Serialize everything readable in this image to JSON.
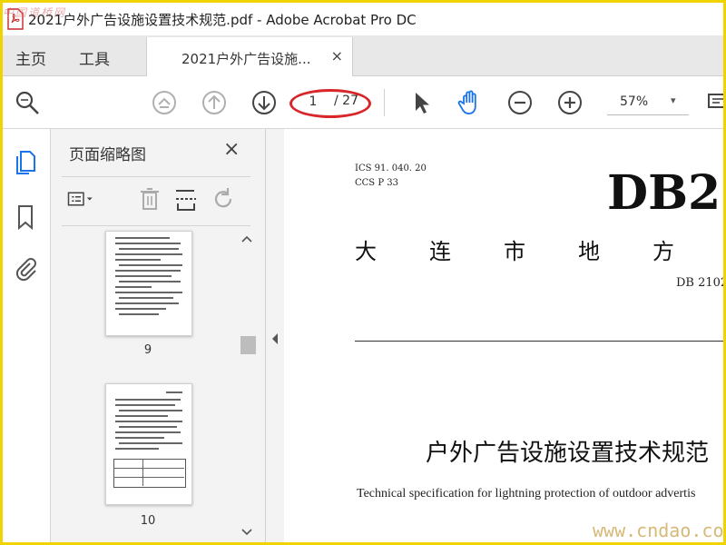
{
  "window": {
    "title": "2021户外广告设施设置技术规范.pdf - Adobe Acrobat Pro DC",
    "watermark_top": "中国道桥网"
  },
  "menu": {
    "home": "主页",
    "tools": "工具"
  },
  "tab": {
    "label": "2021户外广告设施...",
    "close": "×"
  },
  "toolbar": {
    "page_current": "1",
    "page_total": "/ 27",
    "zoom": "57%",
    "zoom_caret": "▾",
    "icons": [
      "search-zoom-icon",
      "page-up-double-icon",
      "arrow-up-icon",
      "arrow-down-icon",
      "select-pointer-icon",
      "hand-tool-icon",
      "zoom-out-icon",
      "zoom-in-icon",
      "comment-tool-icon"
    ],
    "accent_color": "#1a73e8",
    "highlight_color": "#d8262b"
  },
  "rail": {
    "icons": [
      "page-thumbnails-icon",
      "bookmark-icon",
      "attachment-icon"
    ]
  },
  "thumbnails": {
    "title": "页面缩略图",
    "close": "×",
    "pages": [
      {
        "label": "9"
      },
      {
        "label": "10"
      }
    ]
  },
  "document": {
    "ics": "ICS  91. 040. 20",
    "ccs": "CCS P  33",
    "db_mark": "DB2",
    "standard_type": "大连市地方标",
    "code": "DB 2102",
    "title": "户外广告设施设置技术规范",
    "subtitle_en": "Technical specification for lightning protection of outdoor advertis"
  },
  "watermark_bottom": "www.cndao.com"
}
